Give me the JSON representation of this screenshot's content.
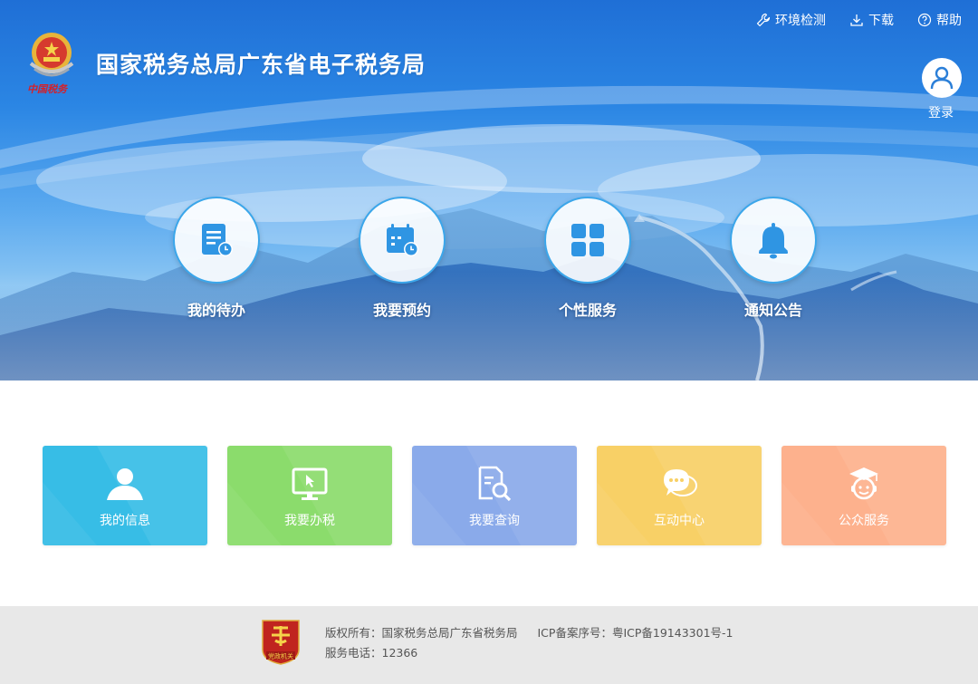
{
  "header": {
    "site_title": "国家税务总局广东省电子税务局",
    "logo_caption": "中国税务",
    "links": [
      {
        "label": "环境检测",
        "icon": "wrench-icon"
      },
      {
        "label": "下载",
        "icon": "download-icon"
      },
      {
        "label": "帮助",
        "icon": "help-icon"
      }
    ],
    "login_label": "登录"
  },
  "quick_access": [
    {
      "label": "我的待办",
      "icon": "todo-list-icon"
    },
    {
      "label": "我要预约",
      "icon": "calendar-icon"
    },
    {
      "label": "个性服务",
      "icon": "grid-icon"
    },
    {
      "label": "通知公告",
      "icon": "bell-icon"
    }
  ],
  "services": [
    {
      "label": "我的信息",
      "icon": "user-icon",
      "color": "#37bde6"
    },
    {
      "label": "我要办税",
      "icon": "monitor-icon",
      "color": "#8bdc6c"
    },
    {
      "label": "我要查询",
      "icon": "document-search-icon",
      "color": "#8aaaea"
    },
    {
      "label": "互动中心",
      "icon": "chat-icon",
      "color": "#f8d066"
    },
    {
      "label": "公众服务",
      "icon": "graduate-icon",
      "color": "#fdb18d"
    }
  ],
  "footer": {
    "copyright": "版权所有：国家税务总局广东省税务局",
    "icp": "ICP备案序号：粤ICP备19143301号-1",
    "phone": "服务电话：12366",
    "badge_text": "党政机关"
  },
  "colors": {
    "hero_top": "#1f6fd6",
    "circle_border": "#3ba6ea",
    "icon_blue": "#2f95e3",
    "footer_bg": "#e8e8e8"
  }
}
